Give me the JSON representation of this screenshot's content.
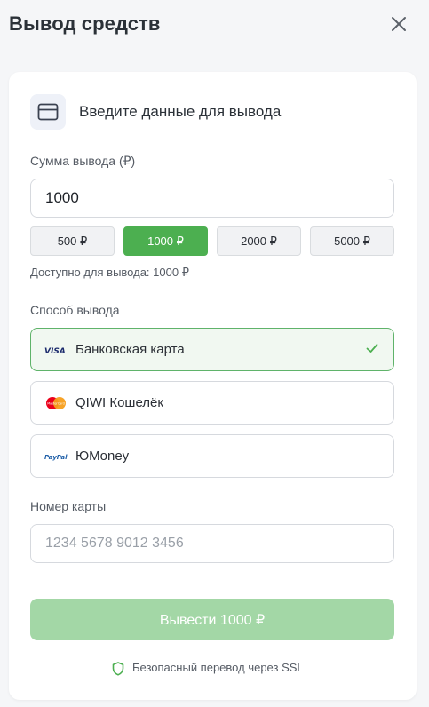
{
  "header": {
    "title": "Вывод средств",
    "close_icon": "close-icon"
  },
  "card": {
    "heading": "Введите данные для вывода",
    "heading_icon": "credit-card-icon"
  },
  "amount": {
    "label": "Сумма вывода (₽)",
    "value": "1000",
    "presets": [
      {
        "label": "500 ₽",
        "active": false
      },
      {
        "label": "1000 ₽",
        "active": true
      },
      {
        "label": "2000 ₽",
        "active": false
      },
      {
        "label": "5000 ₽",
        "active": false
      }
    ],
    "available": "Доступно для вывода: 1000 ₽"
  },
  "method": {
    "label": "Способ вывода",
    "options": [
      {
        "name": "Банковская карта",
        "logo": "visa-logo",
        "logo_text": "VISA",
        "selected": true
      },
      {
        "name": "QIWI Кошелёк",
        "logo": "mastercard-logo",
        "logo_text": "MasterCard",
        "selected": false
      },
      {
        "name": "ЮMoney",
        "logo": "paypal-logo",
        "logo_text": "PayPal",
        "selected": false
      }
    ]
  },
  "card_number": {
    "label": "Номер карты",
    "placeholder": "1234 5678 9012 3456",
    "value": ""
  },
  "submit": {
    "label": "Вывести 1000 ₽"
  },
  "security": {
    "text": "Безопасный перевод через SSL",
    "icon": "shield-icon"
  },
  "colors": {
    "accent": "#4caf50",
    "accent_disabled": "#a3d7a6",
    "selected_border": "#5fb36a",
    "selected_bg": "#f1f8f1",
    "background": "#f5f6f8"
  }
}
